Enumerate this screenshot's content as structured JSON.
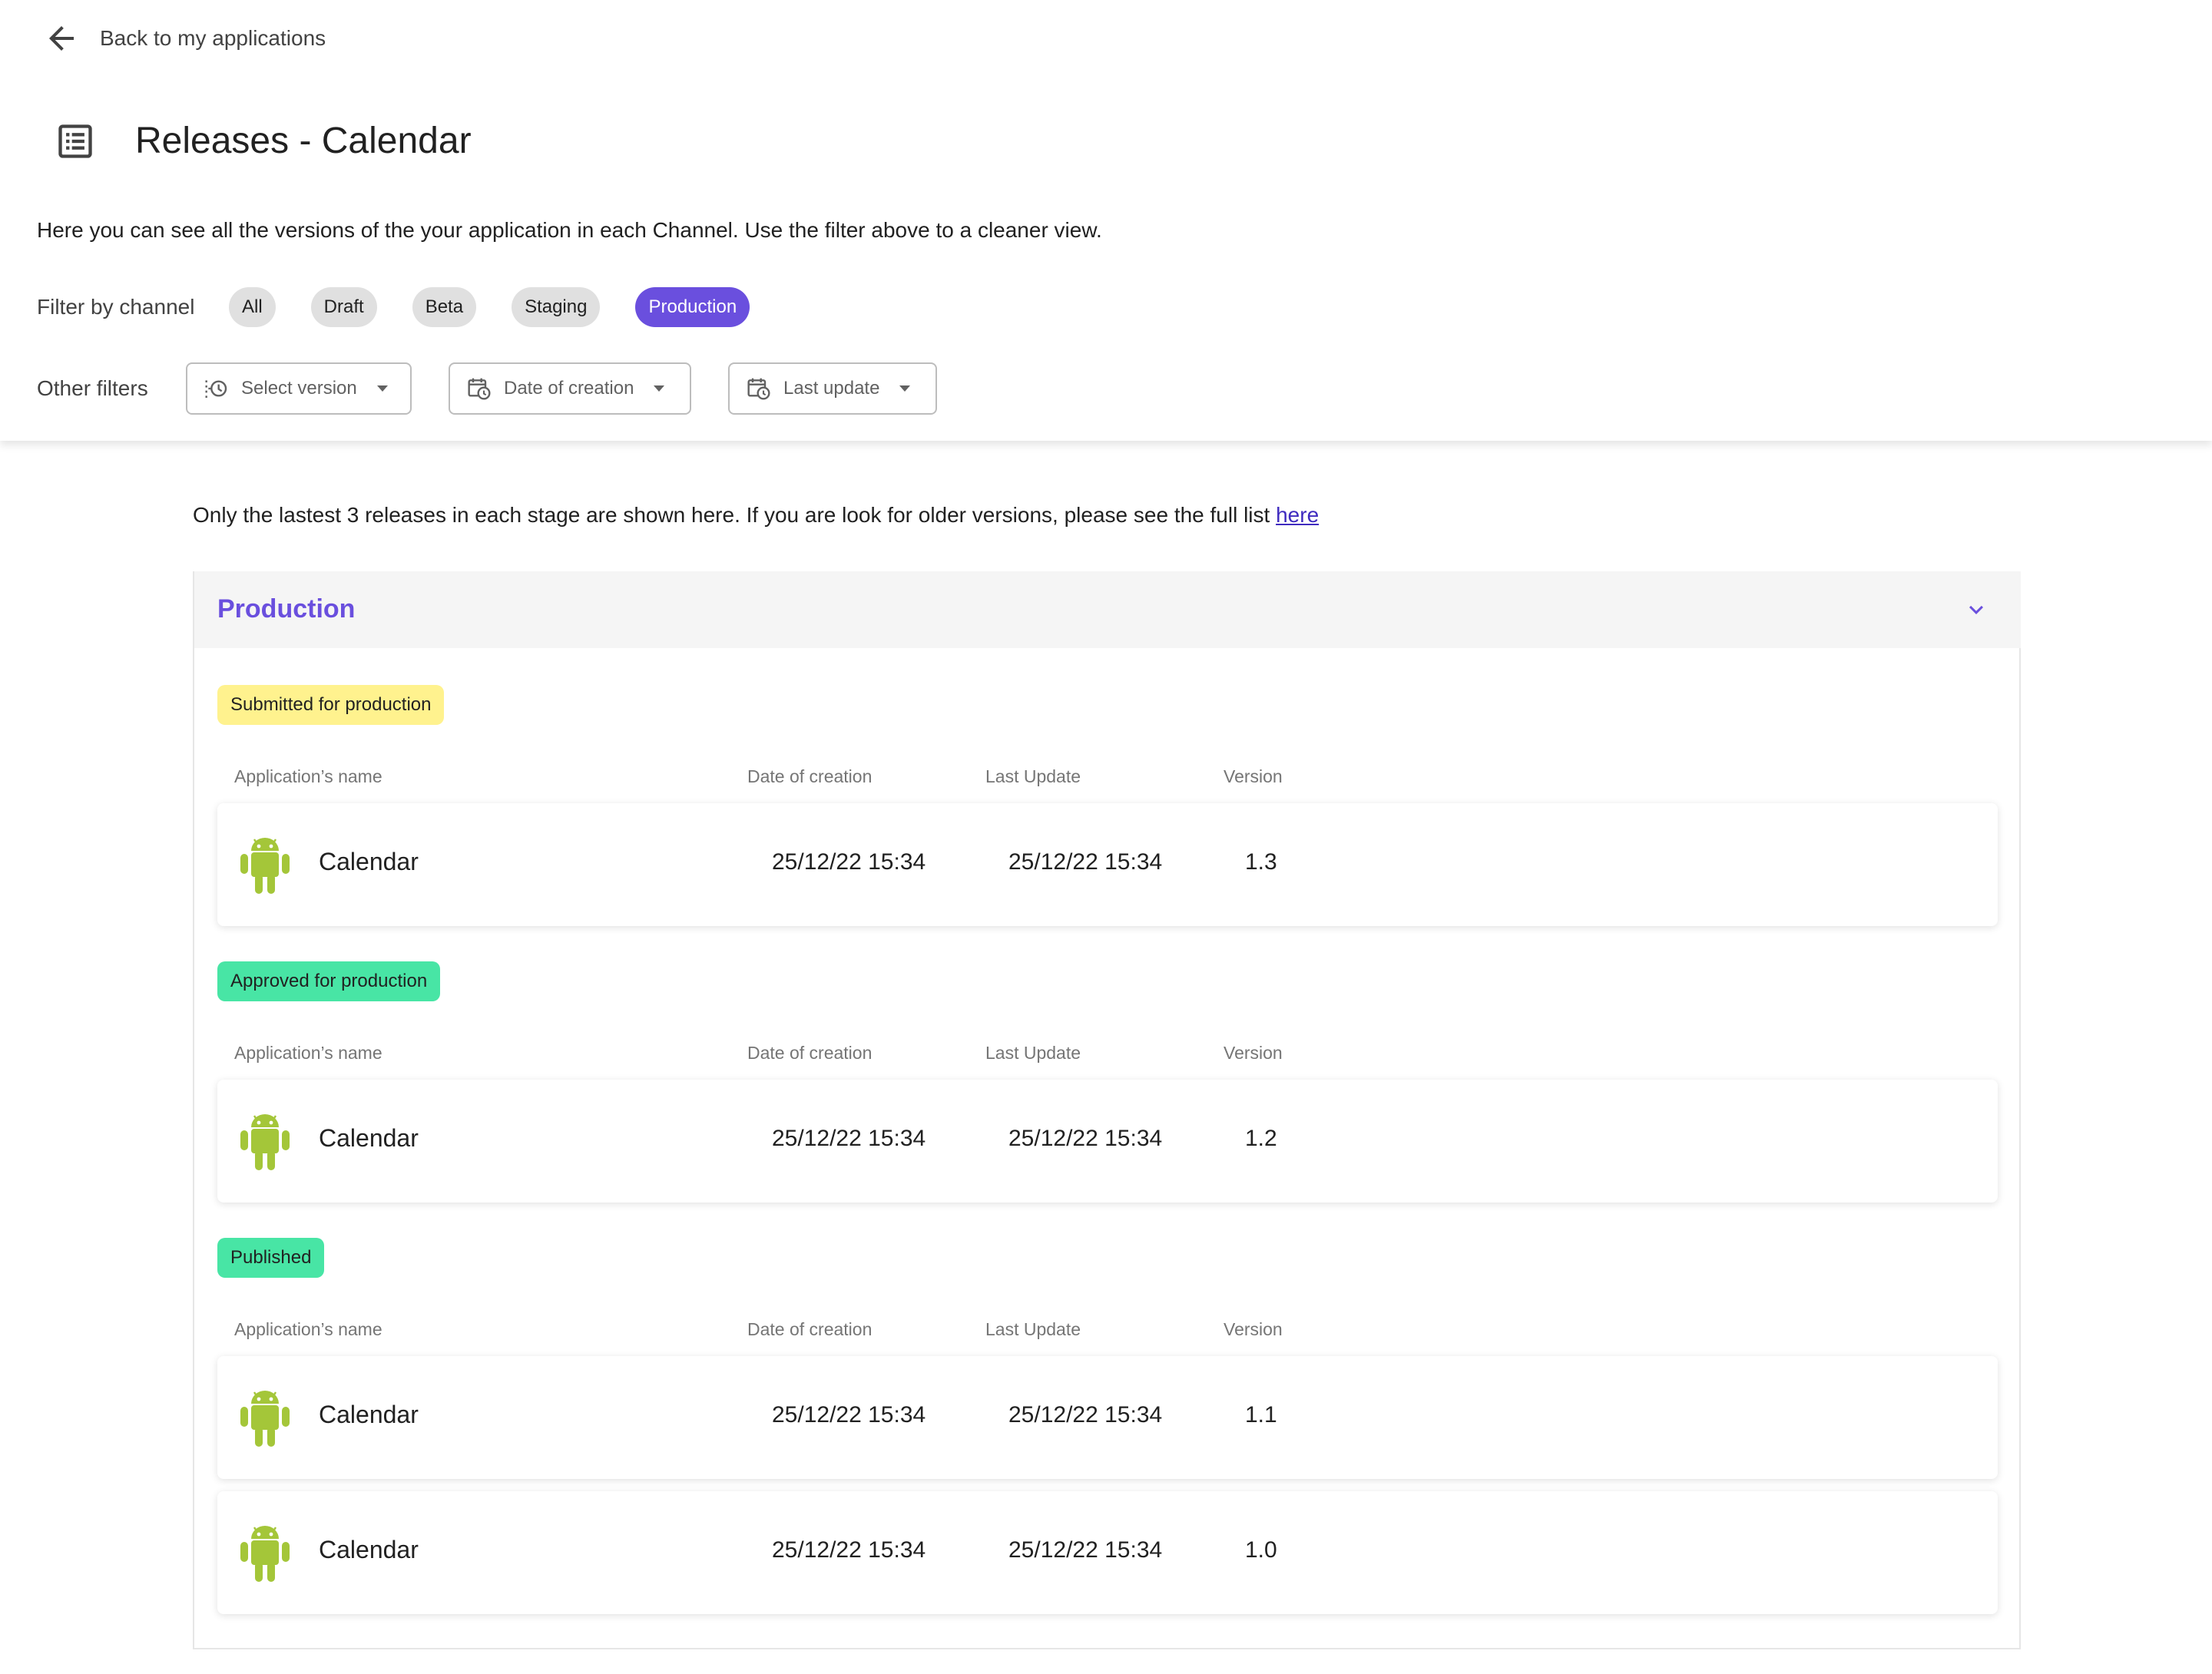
{
  "nav": {
    "back_label": "Back to my applications"
  },
  "page": {
    "title": "Releases - Calendar",
    "description": "Here you can see all the versions of the your application in each Channel. Use the filter above to a cleaner view."
  },
  "filters": {
    "channel_label": "Filter by channel",
    "channels": [
      "All",
      "Draft",
      "Beta",
      "Staging",
      "Production"
    ],
    "active_channel": "Production",
    "other_label": "Other filters",
    "dropdowns": {
      "version": "Select version",
      "creation": "Date of creation",
      "update": "Last update"
    }
  },
  "notice": {
    "text": "Only the lastest 3 releases in each stage are shown here. If you are look for older versions, please see the full list ",
    "link": "here"
  },
  "section": {
    "title": "Production",
    "columns": {
      "name": "Application’s name",
      "created": "Date of creation",
      "updated": "Last Update",
      "version": "Version"
    },
    "groups": [
      {
        "status": "Submitted for production",
        "color": "#fff28e",
        "rows": [
          {
            "name": "Calendar",
            "created": "25/12/22 15:34",
            "updated": "25/12/22 15:34",
            "version": "1.3"
          }
        ]
      },
      {
        "status": "Approved for production",
        "color": "#48e5a5",
        "rows": [
          {
            "name": "Calendar",
            "created": "25/12/22 15:34",
            "updated": "25/12/22 15:34",
            "version": "1.2"
          }
        ]
      },
      {
        "status": "Published",
        "color": "#48e5a5",
        "rows": [
          {
            "name": "Calendar",
            "created": "25/12/22 15:34",
            "updated": "25/12/22 15:34",
            "version": "1.1"
          },
          {
            "name": "Calendar",
            "created": "25/12/22 15:34",
            "updated": "25/12/22 15:34",
            "version": "1.0"
          }
        ]
      }
    ]
  },
  "colors": {
    "accent": "#6a4fde",
    "android": "#a4c639"
  },
  "icons": {
    "back": "arrow-left-icon",
    "page": "list-icon",
    "collapse": "chevron-down-icon",
    "app": "android-icon"
  }
}
